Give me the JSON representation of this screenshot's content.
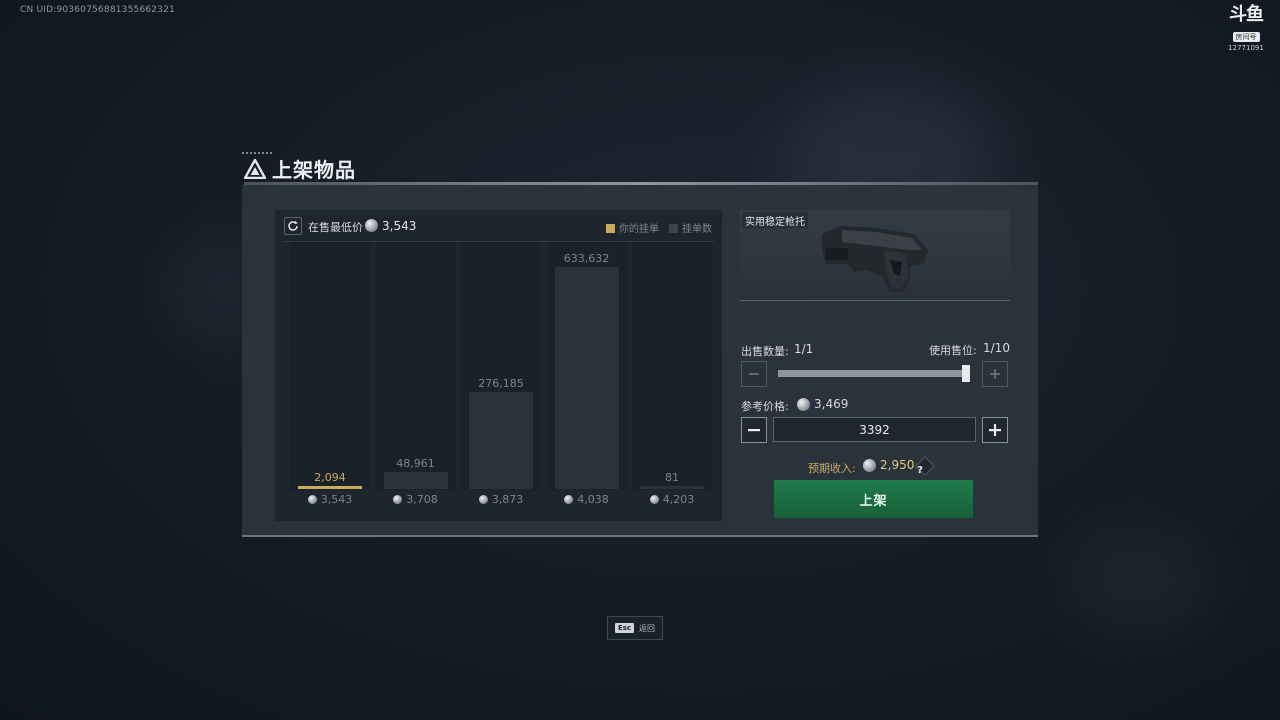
{
  "overlay": {
    "uid_text": "CN UID:9036075688135566232​1",
    "watermark_logo": "斗鱼",
    "watermark_room_label": "房间号",
    "watermark_room_id": "12771091"
  },
  "dialog": {
    "title": "上架物品",
    "lowest_price_label": "在售最低价",
    "lowest_price_value": "3,543",
    "legend_mine": "你的挂单",
    "legend_listings": "挂单数",
    "item_name": "实用稳定枪托",
    "quantity_label": "出售数量:",
    "quantity_value": "1/1",
    "slots_label": "使用售位:",
    "slots_value": "1/10",
    "slider_fraction": 1.0,
    "reference_price_label": "参考价格:",
    "reference_price_value": "3,469",
    "price_input_value": "3392",
    "expected_income_label": "预期收入:",
    "expected_income_value": "2,950",
    "help_symbol": "?",
    "list_button_label": "上架"
  },
  "footer": {
    "esc_key": "Esc",
    "esc_label": "返回"
  },
  "colors": {
    "mine_bar": "#c9ac5e",
    "listing_bar": "#2b3238",
    "list_button": "#1f7a4a"
  },
  "chart_data": {
    "type": "bar",
    "categories": [
      "3,543",
      "3,708",
      "3,873",
      "4,038",
      "4,203"
    ],
    "values": [
      2094,
      48961,
      276185,
      633632,
      81
    ],
    "value_labels": [
      "2,094",
      "48,961",
      "276,185",
      "633,632",
      "81"
    ],
    "highlight_index": 0,
    "title": "",
    "xlabel": "",
    "ylabel": "",
    "ylim": [
      0,
      633632
    ]
  }
}
